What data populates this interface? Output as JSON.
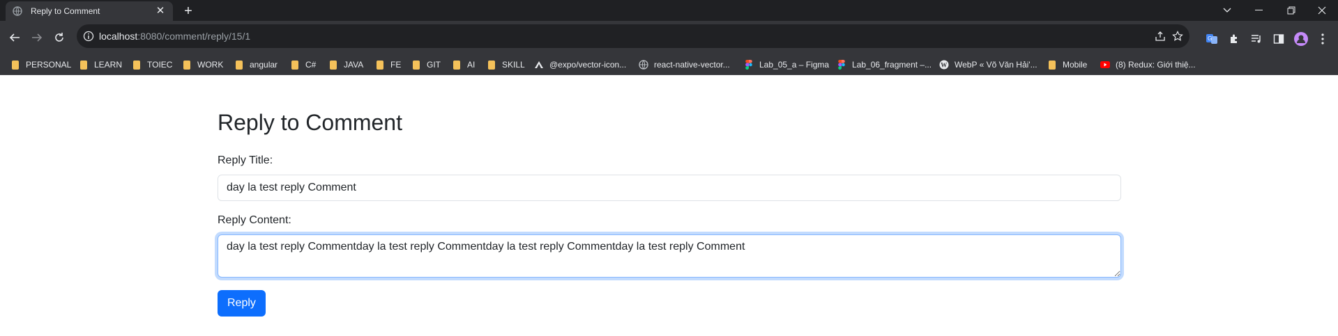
{
  "browser": {
    "tab_title": "Reply to Comment",
    "url_host": "localhost",
    "url_path": ":8080/comment/reply/15/1",
    "bookmarks": [
      {
        "label": "PERSONAL",
        "icon": "folder-icon"
      },
      {
        "label": "LEARN",
        "icon": "folder-icon"
      },
      {
        "label": "TOIEC",
        "icon": "folder-icon"
      },
      {
        "label": "WORK",
        "icon": "folder-icon"
      },
      {
        "label": "angular",
        "icon": "folder-icon"
      },
      {
        "label": "C#",
        "icon": "folder-icon"
      },
      {
        "label": "JAVA",
        "icon": "folder-icon"
      },
      {
        "label": "FE",
        "icon": "folder-icon"
      },
      {
        "label": "GIT",
        "icon": "folder-icon"
      },
      {
        "label": "AI",
        "icon": "folder-icon"
      },
      {
        "label": "SKILL",
        "icon": "folder-icon"
      },
      {
        "label": "@expo/vector-icon...",
        "icon": "expo-icon"
      },
      {
        "label": "react-native-vector...",
        "icon": "globe-icon"
      },
      {
        "label": "Lab_05_a – Figma",
        "icon": "figma-icon"
      },
      {
        "label": "Lab_06_fragment –...",
        "icon": "figma-icon"
      },
      {
        "label": "WebP « Võ Văn Hải'...",
        "icon": "wordpress-icon"
      },
      {
        "label": "Mobile",
        "icon": "folder-icon"
      },
      {
        "label": "(8) Redux: Giới thiệ...",
        "icon": "youtube-icon"
      }
    ]
  },
  "page": {
    "heading": "Reply to Comment",
    "title_label": "Reply Title:",
    "title_value": "day la test reply Comment",
    "content_label": "Reply Content:",
    "content_value": "day la test reply Commentday la test reply Commentday la test reply Commentday la test reply Comment",
    "submit_label": "Reply"
  },
  "colors": {
    "primary": "#0d6efd",
    "focus_border": "#86b7fe",
    "text": "#212529",
    "chrome_dark": "#1f2023",
    "chrome_toolbar": "#35363a",
    "folder": "#f4c15a"
  }
}
